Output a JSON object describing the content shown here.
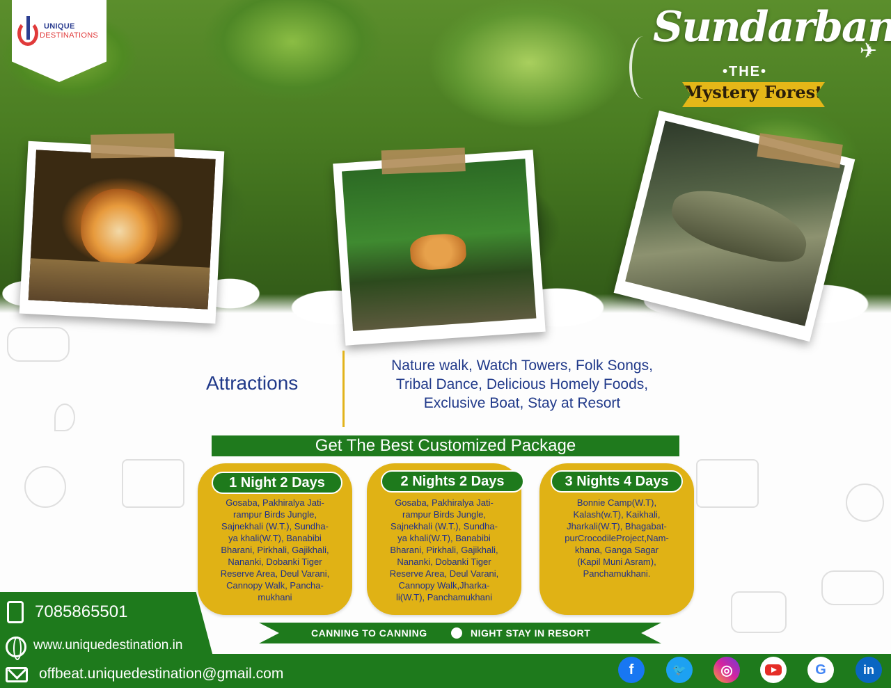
{
  "brand": {
    "logo_line1": "UNIQUE",
    "logo_line2": "DESTINATIONS"
  },
  "title": {
    "main": "Sundarban",
    "the": "•THE•",
    "ribbon": "Mystery Forest"
  },
  "photos": [
    {
      "name": "tiger"
    },
    {
      "name": "spotted-deer"
    },
    {
      "name": "crocodile"
    }
  ],
  "attractions": {
    "heading": "Attractions",
    "lines": [
      "Nature walk, Watch Towers, Folk Songs,",
      "Tribal Dance, Delicious Homely Foods,",
      "Exclusive Boat, Stay at Resort"
    ]
  },
  "package_heading": "Get The Best Customized Package",
  "packages": [
    {
      "title": "1 Night 2 Days",
      "lines": [
        "Gosaba, Pakhiralya Jati-",
        "rampur Birds Jungle,",
        "Sajnekhali (W.T.), Sundha-",
        "ya khali(W.T), Banabibi",
        "Bharani, Pirkhali, Gajikhali,",
        "Nananki, Dobanki Tiger",
        "Reserve Area,  Deul Varani,",
        "Cannopy Walk, Pancha-",
        "mukhani"
      ]
    },
    {
      "title": "2 Nights 2 Days",
      "lines": [
        "Gosaba, Pakhiralya Jati-",
        "rampur Birds Jungle,",
        "Sajnekhali (W.T.), Sundha-",
        "ya khali(W.T), Banabibi",
        "Bharani, Pirkhali, Gajikhali,",
        "Nananki, Dobanki Tiger",
        "Reserve Area,  Deul Varani,",
        "Cannopy Walk,Jharka-",
        "li(W.T), Panchamukhani"
      ]
    },
    {
      "title": "3 Nights 4 Days",
      "lines": [
        "Bonnie Camp(W.T),",
        "Kalash(w.T), Kaikhali,",
        "Jharkali(W.T), Bhagabat-",
        "purCrocodileProject,Nam-",
        "khana, Ganga Sagar",
        "(Kapil Muni Asram),",
        "Panchamukhani."
      ]
    }
  ],
  "ribbon": {
    "left": "CANNING TO CANNING",
    "right": "NIGHT STAY IN RESORT"
  },
  "contact": {
    "phone": "7085865501",
    "website": "www.uniquedestination.in",
    "email": "offbeat.uniquedestination@gmail.com"
  },
  "socials": {
    "facebook": "f",
    "twitter": "🐦",
    "instagram": "◎",
    "youtube": "",
    "google": "G",
    "linkedin": "in"
  },
  "colors": {
    "green": "#1e7a1c",
    "gold": "#e0b215",
    "navy": "#213a8a"
  }
}
